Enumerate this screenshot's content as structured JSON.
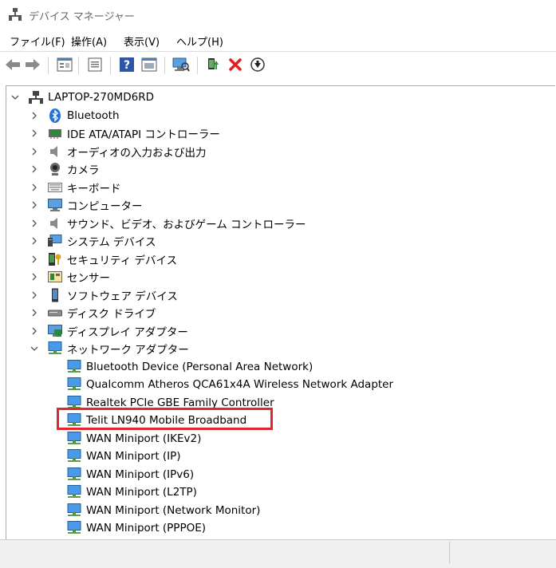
{
  "window": {
    "title": "デバイス マネージャー"
  },
  "menu": [
    "ファイル(F)",
    "操作(A)",
    "表示(V)",
    "ヘルプ(H)"
  ],
  "toolbar": {
    "buttons": [
      "back-icon",
      "forward-icon",
      "properties-icon",
      "update-view-icon",
      "help-icon",
      "view-icon",
      "scan-hardware-icon",
      "update-driver-icon",
      "uninstall-icon",
      "download-icon"
    ]
  },
  "tree": {
    "root": "LAPTOP-270MD6RD",
    "categories": [
      "Bluetooth",
      "IDE ATA/ATAPI コントローラー",
      "オーディオの入力および出力",
      "カメラ",
      "キーボード",
      "コンピューター",
      "サウンド、ビデオ、およびゲーム コントローラー",
      "システム デバイス",
      "セキュリティ デバイス",
      "センサー",
      "ソフトウェア デバイス",
      "ディスク ドライブ",
      "ディスプレイ アダプター",
      "ネットワーク アダプター"
    ],
    "network_adapters": [
      "Bluetooth Device (Personal Area Network)",
      "Qualcomm Atheros QCA61x4A Wireless Network Adapter",
      "Realtek PCIe GBE Family Controller",
      "Telit LN940 Mobile Broadband",
      "WAN Miniport (IKEv2)",
      "WAN Miniport (IP)",
      "WAN Miniport (IPv6)",
      "WAN Miniport (L2TP)",
      "WAN Miniport (Network Monitor)",
      "WAN Miniport (PPPOE)"
    ]
  },
  "colors": {
    "highlight_border": "#e0262f",
    "accent_blue": "#1e73d8"
  }
}
